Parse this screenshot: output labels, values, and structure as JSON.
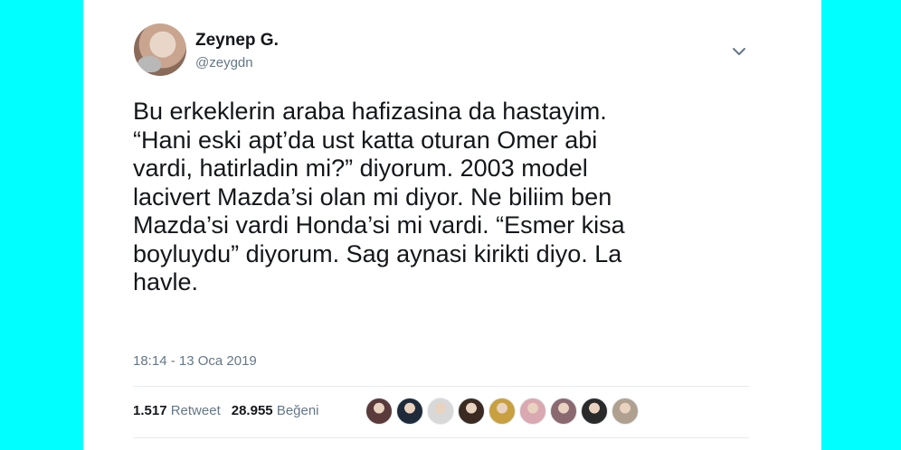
{
  "user": {
    "name": "Zeynep G.",
    "handle": "@zeygdn"
  },
  "tweet": {
    "lines": [
      "Bu erkeklerin araba hafizasina da hastayim.",
      "“Hani eski apt’da ust katta oturan Omer abi",
      "vardi, hatirladin mi?” diyorum. 2003 model",
      "lacivert Mazda’si olan mi diyor. Ne biliim ben",
      "Mazda’si vardi Honda’si mi vardi. “Esmer kisa",
      "boyluydu” diyorum. Sag aynasi kirikti diyo. La",
      "havle."
    ],
    "timestamp": "18:14 - 13 Oca 2019"
  },
  "stats": {
    "retweet_count": "1.517",
    "retweet_label": "Retweet",
    "like_count": "28.955",
    "like_label": "Beğeni"
  },
  "icons": {
    "menu": "chevron-down-icon"
  },
  "colors": {
    "background": "#00ffff",
    "card": "#ffffff",
    "text": "#14171a",
    "muted": "#657786",
    "divider": "#e6ecf0"
  },
  "liker_avatars": [
    {
      "id": "liker-1",
      "color": "#5a3a3a"
    },
    {
      "id": "liker-2",
      "color": "#1f2a3a"
    },
    {
      "id": "liker-3",
      "color": "#d8d8d8"
    },
    {
      "id": "liker-4",
      "color": "#3a2a22"
    },
    {
      "id": "liker-5",
      "color": "#c8a040"
    },
    {
      "id": "liker-6",
      "color": "#d9a8b0"
    },
    {
      "id": "liker-7",
      "color": "#8a6a70"
    },
    {
      "id": "liker-8",
      "color": "#2a2a2a"
    },
    {
      "id": "liker-9",
      "color": "#b0a090"
    }
  ]
}
